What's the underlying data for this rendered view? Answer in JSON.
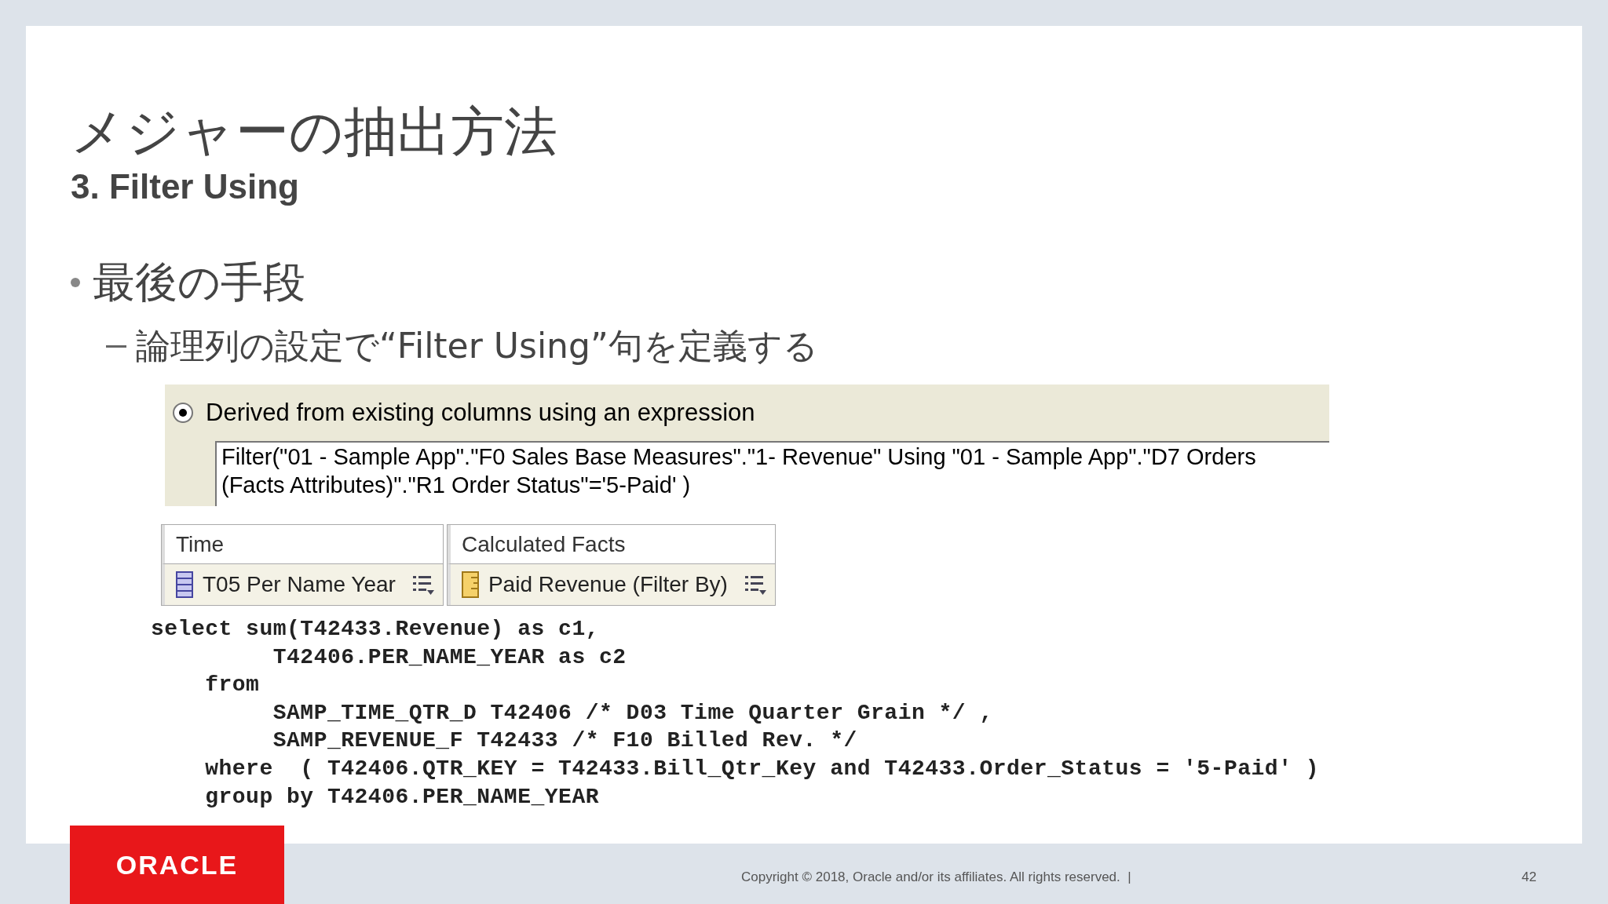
{
  "slide": {
    "title": "メジャーの抽出方法",
    "subtitle": "3. Filter Using",
    "bullet": "最後の手段",
    "sub_bullet": "論理列の設定で“Filter Using”句を定義する",
    "screenshot": {
      "radio": {
        "label": "Derived from existing columns using an expression",
        "selected": true
      },
      "expression": "Filter(\"01 - Sample App\".\"F0 Sales Base Measures\".\"1- Revenue\"  Using  \"01 - Sample App\".\"D7 Orders (Facts Attributes)\".\"R1  Order Status\"='5-Paid' )",
      "columns": [
        {
          "heading": "Time",
          "item": "T05 Per Name Year",
          "kind": "attribute"
        },
        {
          "heading": "Calculated Facts",
          "item": "Paid Revenue (Filter By)",
          "kind": "measure"
        }
      ]
    },
    "sql": [
      "select sum(T42433.Revenue) as c1,",
      "         T42406.PER_NAME_YEAR as c2",
      "    from",
      "         SAMP_TIME_QTR_D T42406 /* D03 Time Quarter Grain */ ,",
      "         SAMP_REVENUE_F T42433 /* F10 Billed Rev. */",
      "    where  ( T42406.QTR_KEY = T42433.Bill_Qtr_Key and T42433.Order_Status = '5-Paid' )",
      "    group by T42406.PER_NAME_YEAR"
    ]
  },
  "footer": {
    "logo": "ORACLE",
    "copyright": "Copyright © 2018, Oracle and/or its affiliates. All rights reserved.  |",
    "page": "42"
  }
}
